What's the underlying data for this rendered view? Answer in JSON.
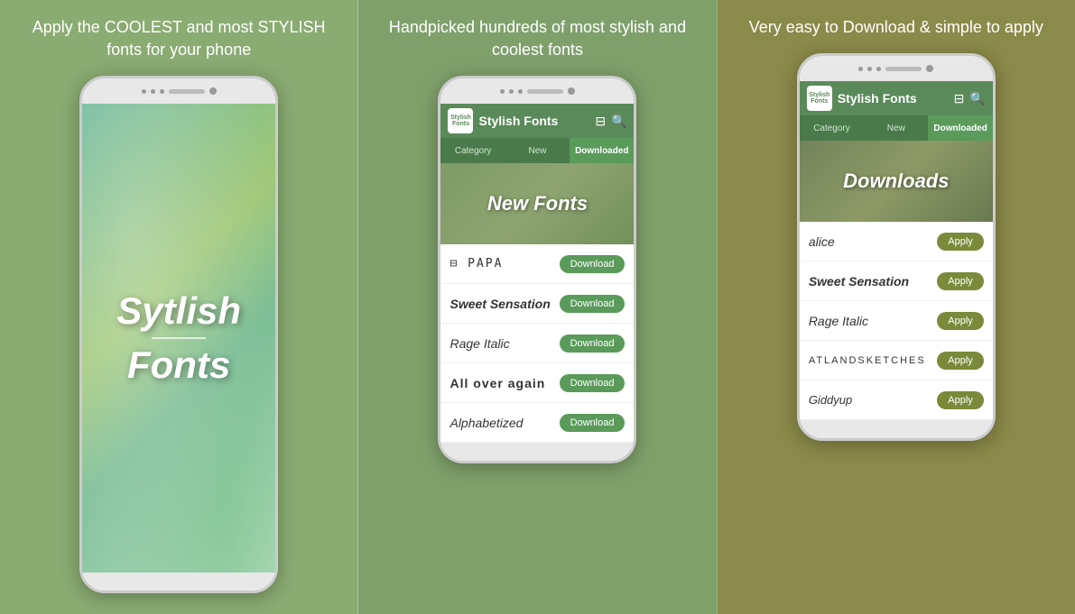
{
  "panels": [
    {
      "id": "panel-1",
      "tagline": "Apply the COOLEST and most STYLISH fonts for your phone",
      "phone": {
        "type": "splash",
        "splash_title_line1": "Sytlish",
        "splash_title_line2": "Fonts"
      }
    },
    {
      "id": "panel-2",
      "tagline": "Handpicked hundreds of most stylish and coolest fonts",
      "phone": {
        "type": "new-fonts",
        "app_title": "Stylish Fonts",
        "app_icon_line1": "Stylish",
        "app_icon_line2": "Fonts",
        "tabs": [
          "Category",
          "New",
          "Downloaded"
        ],
        "active_tab": "New",
        "banner_text": "New Fonts",
        "fonts": [
          {
            "name": "⊟ PAPA",
            "style": "font-papa",
            "action": "Download"
          },
          {
            "name": "Sweet Sensation",
            "style": "font-sweet",
            "action": "Download"
          },
          {
            "name": "Rage Italic",
            "style": "font-rage",
            "action": "Download"
          },
          {
            "name": "All over again",
            "style": "font-allover",
            "action": "Download"
          },
          {
            "name": "Alphabetized",
            "style": "font-alpha",
            "action": "Download"
          }
        ]
      }
    },
    {
      "id": "panel-3",
      "tagline": "Very easy to Download & simple to apply",
      "phone": {
        "type": "downloads",
        "app_title": "Stylish Fonts",
        "app_icon_line1": "Stylish",
        "app_icon_line2": "Fonts",
        "tabs": [
          "Category",
          "New",
          "Downloaded"
        ],
        "active_tab": "Downloaded",
        "banner_text": "Downloads",
        "fonts": [
          {
            "name": "alice",
            "style": "font-alice",
            "action": "Apply"
          },
          {
            "name": "Sweet Sensation",
            "style": "font-sweet",
            "action": "Apply"
          },
          {
            "name": "Rage Italic",
            "style": "font-rage",
            "action": "Apply"
          },
          {
            "name": "ATLANDSKETCHES",
            "style": "font-atland",
            "action": "Apply"
          },
          {
            "name": "Giddyup",
            "style": "font-giddy",
            "action": "Apply"
          }
        ]
      }
    }
  ]
}
